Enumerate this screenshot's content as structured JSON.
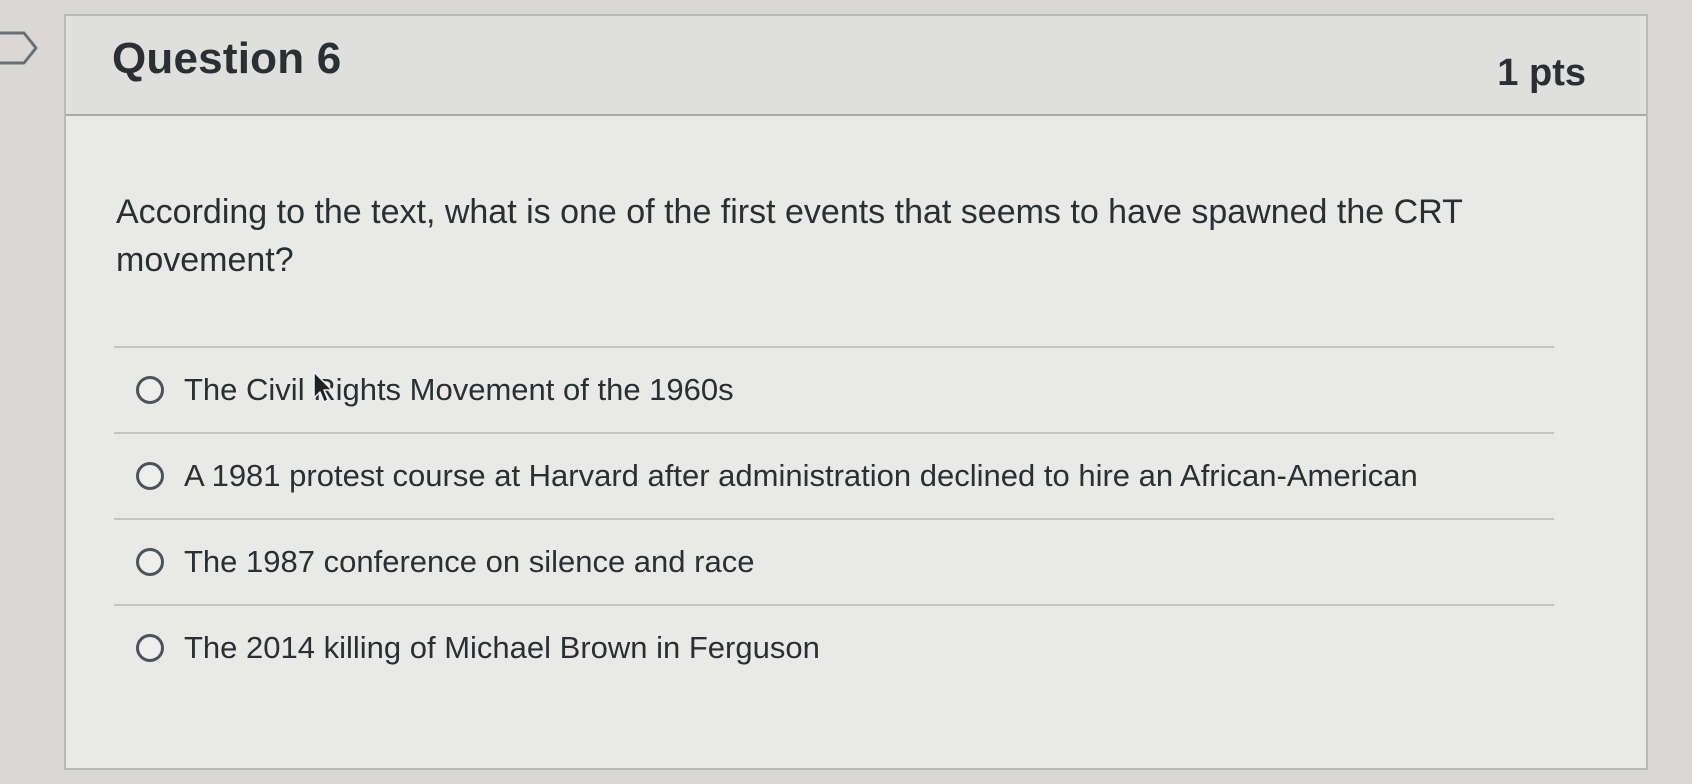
{
  "question": {
    "title": "Question 6",
    "points": "1 pts",
    "text": "According to the text, what is one of the first events that seems to have spawned the CRT movement?"
  },
  "answers": [
    {
      "label": "The Civil Rights Movement of the 1960s"
    },
    {
      "label": "A 1981 protest course at Harvard after administration declined to hire an African-American"
    },
    {
      "label": "The 1987 conference on silence and race"
    },
    {
      "label": "The 2014 killing of Michael Brown in Ferguson"
    }
  ],
  "icons": {
    "flag": "flag-icon",
    "radio": "radio-unselected-icon",
    "cursor": "mouse-pointer-icon"
  },
  "colors": {
    "background": "#d9d8d6",
    "card": "#e9e9e8",
    "header": "#dfdfde",
    "text": "#2a2f33"
  }
}
